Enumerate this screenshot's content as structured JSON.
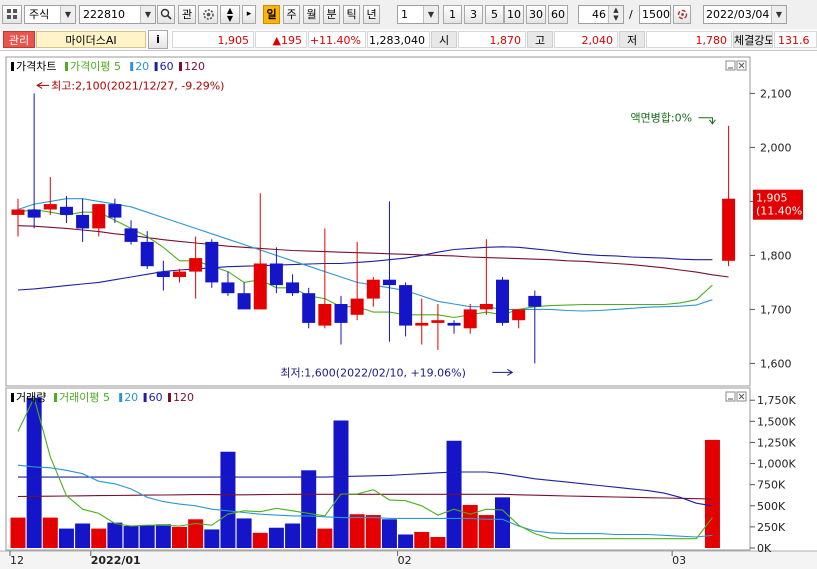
{
  "toolbar": {
    "market": "주식",
    "code": "222810",
    "watch_label": "관",
    "periods": [
      "일",
      "주",
      "월",
      "분",
      "틱",
      "년"
    ],
    "active_period": "일",
    "interval_value": "1",
    "interval_buttons": [
      "1",
      "3",
      "5",
      "10",
      "30",
      "60"
    ],
    "count": "46",
    "slash": "/",
    "max_count": "1500",
    "date": "2022/03/04"
  },
  "quote": {
    "management_badge": "관리",
    "name": "마이더스AI",
    "info_button": "i",
    "price": "1,905",
    "change": "▲195",
    "change_pct": "+11.40%",
    "volume": "1,283,040",
    "open_label": "시",
    "open": "1,870",
    "high_label": "고",
    "high": "2,040",
    "low_label": "저",
    "low": "1,780",
    "strength_label": "체결강도",
    "strength": "131.6"
  },
  "colors": {
    "up": "#e40000",
    "down": "#1414c8",
    "ma5": "#4caf1e",
    "ma20": "#2d96d2",
    "ma60": "#1e1ea8",
    "ma120": "#7a1030"
  },
  "chart_data": [
    {
      "type": "candlestick",
      "legend": [
        "가격차트",
        "가격이평 5",
        "20",
        "60",
        "120"
      ],
      "ylim": [
        1560,
        2160
      ],
      "y_ticks": [
        "2,100",
        "2,000",
        "1,900",
        "1,800",
        "1,700",
        "1,600"
      ],
      "y_tick_values": [
        2100,
        2000,
        1900,
        1800,
        1700,
        1600
      ],
      "x_labels": [
        "12",
        "2022/01",
        "02",
        "03"
      ],
      "x_label_index": [
        0,
        5,
        24,
        41
      ],
      "candles": [
        {
          "o": 1875,
          "h": 1905,
          "l": 1835,
          "c": 1885
        },
        {
          "o": 1885,
          "h": 2100,
          "l": 1850,
          "c": 1870
        },
        {
          "o": 1885,
          "h": 1945,
          "l": 1875,
          "c": 1895
        },
        {
          "o": 1890,
          "h": 1910,
          "l": 1860,
          "c": 1875
        },
        {
          "o": 1875,
          "h": 1905,
          "l": 1825,
          "c": 1850
        },
        {
          "o": 1850,
          "h": 1895,
          "l": 1835,
          "c": 1895
        },
        {
          "o": 1895,
          "h": 1905,
          "l": 1860,
          "c": 1870
        },
        {
          "o": 1850,
          "h": 1865,
          "l": 1820,
          "c": 1825
        },
        {
          "o": 1825,
          "h": 1845,
          "l": 1775,
          "c": 1780
        },
        {
          "o": 1770,
          "h": 1790,
          "l": 1735,
          "c": 1760
        },
        {
          "o": 1760,
          "h": 1775,
          "l": 1750,
          "c": 1770
        },
        {
          "o": 1770,
          "h": 1835,
          "l": 1720,
          "c": 1795
        },
        {
          "o": 1825,
          "h": 1830,
          "l": 1740,
          "c": 1750
        },
        {
          "o": 1750,
          "h": 1770,
          "l": 1725,
          "c": 1730
        },
        {
          "o": 1730,
          "h": 1750,
          "l": 1705,
          "c": 1700
        },
        {
          "o": 1700,
          "h": 1915,
          "l": 1700,
          "c": 1785
        },
        {
          "o": 1785,
          "h": 1815,
          "l": 1730,
          "c": 1745
        },
        {
          "o": 1750,
          "h": 1765,
          "l": 1725,
          "c": 1730
        },
        {
          "o": 1730,
          "h": 1740,
          "l": 1665,
          "c": 1675
        },
        {
          "o": 1670,
          "h": 1850,
          "l": 1665,
          "c": 1710
        },
        {
          "o": 1710,
          "h": 1725,
          "l": 1635,
          "c": 1675
        },
        {
          "o": 1690,
          "h": 1825,
          "l": 1680,
          "c": 1720
        },
        {
          "o": 1720,
          "h": 1760,
          "l": 1705,
          "c": 1755
        },
        {
          "o": 1755,
          "h": 1900,
          "l": 1640,
          "c": 1745
        },
        {
          "o": 1745,
          "h": 1750,
          "l": 1650,
          "c": 1670
        },
        {
          "o": 1670,
          "h": 1720,
          "l": 1635,
          "c": 1675
        },
        {
          "o": 1675,
          "h": 1710,
          "l": 1625,
          "c": 1680
        },
        {
          "o": 1675,
          "h": 1680,
          "l": 1655,
          "c": 1670
        },
        {
          "o": 1665,
          "h": 1710,
          "l": 1655,
          "c": 1700
        },
        {
          "o": 1700,
          "h": 1830,
          "l": 1690,
          "c": 1710
        },
        {
          "o": 1755,
          "h": 1760,
          "l": 1670,
          "c": 1675
        },
        {
          "o": 1680,
          "h": 1700,
          "l": 1665,
          "c": 1700
        },
        {
          "o": 1725,
          "h": 1735,
          "l": 1600,
          "c": 1705
        },
        null,
        null,
        null,
        null,
        null,
        null,
        null,
        null,
        null,
        null,
        null,
        {
          "o": 1790,
          "h": 2040,
          "l": 1780,
          "c": 1905
        }
      ],
      "ma5": [
        1880,
        1885,
        1880,
        1875,
        1880,
        1880,
        1865,
        1850,
        1835,
        1815,
        1790,
        1790,
        1780,
        1770,
        1750,
        1755,
        1740,
        1740,
        1725,
        1720,
        1705,
        1705,
        1695,
        1695,
        1690,
        1690,
        1690,
        1685,
        1690,
        1695,
        1690,
        1700,
        1705,
        1707,
        1708,
        1709,
        1709,
        1709,
        1709,
        1709,
        1709,
        1712,
        1718,
        1745
      ],
      "ma20": [
        1885,
        1895,
        1900,
        1905,
        1905,
        1900,
        1895,
        1890,
        1880,
        1870,
        1860,
        1850,
        1840,
        1830,
        1820,
        1810,
        1800,
        1790,
        1780,
        1770,
        1760,
        1750,
        1745,
        1740,
        1735,
        1725,
        1715,
        1710,
        1705,
        1705,
        1700,
        1700,
        1700,
        1700,
        1698,
        1697,
        1698,
        1700,
        1702,
        1704,
        1705,
        1706,
        1708,
        1718
      ],
      "ma60": [
        1736,
        1738,
        1741,
        1744,
        1747,
        1750,
        1755,
        1760,
        1765,
        1770,
        1773,
        1775,
        1777,
        1779,
        1780,
        1781,
        1782,
        1783,
        1784,
        1785,
        1785,
        1787,
        1789,
        1792,
        1795,
        1800,
        1806,
        1811,
        1813,
        1815,
        1816,
        1815,
        1812,
        1809,
        1805,
        1802,
        1800,
        1799,
        1797,
        1796,
        1795,
        1793,
        1792,
        1792
      ],
      "ma120": [
        1855,
        1854,
        1852,
        1850,
        1847,
        1844,
        1840,
        1837,
        1833,
        1829,
        1826,
        1823,
        1820,
        1817,
        1815,
        1813,
        1811,
        1809,
        1808,
        1807,
        1806,
        1805,
        1804,
        1803,
        1802,
        1801,
        1800,
        1799,
        1797,
        1796,
        1795,
        1794,
        1793,
        1792,
        1790,
        1789,
        1787,
        1785,
        1783,
        1780,
        1777,
        1773,
        1769,
        1764,
        1760
      ],
      "annotations": {
        "high": "최고:2,100(2021/12/27, -9.29%)",
        "low": "최저:1,600(2022/02/10, +19.06%)",
        "par_merge": "액면병합:0%",
        "last_price": "1,905",
        "last_pct": "(11.40%)"
      }
    },
    {
      "type": "bar",
      "legend": [
        "거래량",
        "거래이평 5",
        "20",
        "60",
        "120"
      ],
      "ylim": [
        0,
        1800
      ],
      "y_ticks": [
        "1,750K",
        "1,500K",
        "1,250K",
        "1,000K",
        "750K",
        "500K",
        "250K",
        "0K"
      ],
      "y_tick_values": [
        1750,
        1500,
        1250,
        1000,
        750,
        500,
        250,
        0
      ],
      "unit": "K",
      "volumes": [
        360,
        1780,
        360,
        230,
        290,
        230,
        300,
        260,
        270,
        280,
        250,
        340,
        220,
        1140,
        350,
        180,
        240,
        290,
        920,
        230,
        1510,
        400,
        390,
        340,
        160,
        190,
        130,
        1270,
        510,
        390,
        600,
        null,
        null,
        null,
        null,
        null,
        null,
        null,
        null,
        null,
        null,
        null,
        null,
        1280
      ],
      "ma5": [
        1380,
        1780,
        1080,
        620,
        460,
        410,
        290,
        260,
        270,
        270,
        260,
        290,
        270,
        400,
        440,
        430,
        470,
        440,
        410,
        380,
        640,
        640,
        690,
        570,
        560,
        500,
        390,
        460,
        400,
        460,
        450,
        270,
        170,
        110,
        110,
        110,
        110,
        110,
        110,
        110,
        110,
        110,
        110,
        360
      ],
      "ma20": [
        980,
        960,
        950,
        920,
        880,
        790,
        760,
        700,
        600,
        550,
        520,
        500,
        460,
        440,
        420,
        400,
        390,
        380,
        380,
        370,
        360,
        360,
        360,
        350,
        350,
        350,
        350,
        350,
        350,
        340,
        340,
        260,
        200,
        180,
        170,
        170,
        170,
        160,
        160,
        160,
        150,
        140,
        130,
        150
      ],
      "ma60": [
        840,
        840,
        840,
        840,
        840,
        840,
        840,
        840,
        840,
        840,
        840,
        840,
        840,
        840,
        840,
        840,
        840,
        840,
        840,
        840,
        845,
        850,
        855,
        860,
        870,
        880,
        890,
        900,
        900,
        900,
        880,
        850,
        820,
        800,
        780,
        760,
        740,
        720,
        700,
        680,
        650,
        600,
        530,
        500
      ],
      "ma120": [
        610,
        612,
        614,
        616,
        618,
        620,
        622,
        624,
        626,
        628,
        630,
        632,
        632,
        630,
        630,
        632,
        634,
        636,
        636,
        636,
        636,
        636,
        636,
        636,
        636,
        636,
        636,
        636,
        636,
        636,
        636,
        630,
        625,
        620,
        616,
        612,
        608,
        604,
        600,
        596,
        592,
        588,
        584,
        580
      ]
    }
  ]
}
